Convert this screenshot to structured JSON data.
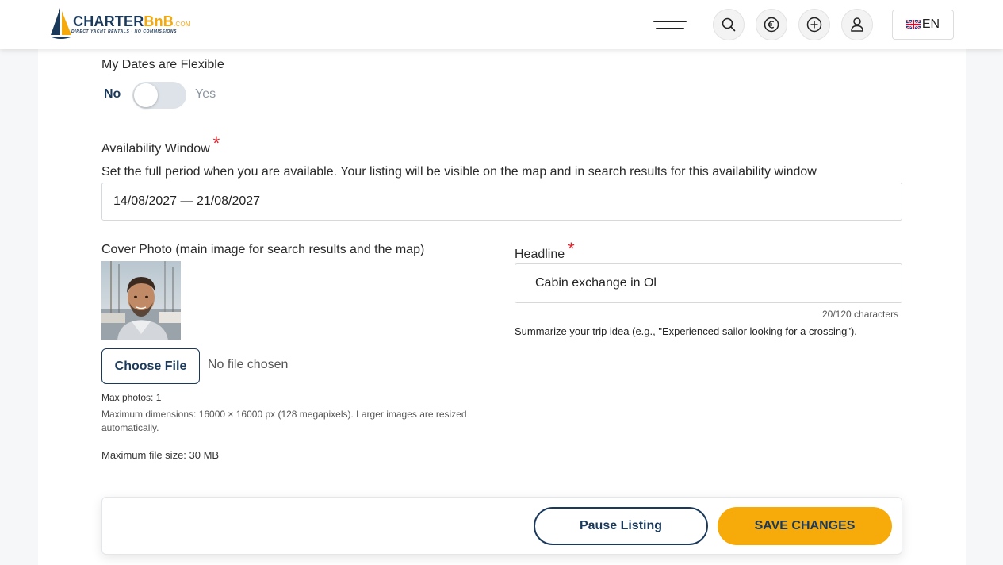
{
  "header": {
    "logo_name": "CHARTER",
    "logo_accent": "BnB",
    "logo_domain": ".COM",
    "logo_tagline": "DIRECT YACHT RENTALS · NO COMMISSIONS",
    "language": "EN",
    "icons": [
      "menu-icon",
      "search-icon",
      "euro-icon",
      "plus-circle-icon",
      "user-icon",
      "uk-flag-icon"
    ]
  },
  "flexible": {
    "label": "My Dates are Flexible",
    "no_label": "No",
    "yes_label": "Yes",
    "state": "No"
  },
  "availability": {
    "label": "Availability Window",
    "required_mark": "*",
    "help": "Set the full period when you are available. Your listing will be visible on the map and in search results for this availability window",
    "value": "14/08/2027 — 21/08/2027"
  },
  "cover_photo": {
    "label": "Cover Photo (main image for search results and the map)",
    "choose_label": "Choose File",
    "no_file": "No file chosen",
    "max_photos": "Max photos: 1",
    "max_dimensions": "Maximum dimensions: 16000 × 16000 px (128 megapixels). Larger images are resized automatically.",
    "max_size": "Maximum file size: 30 MB"
  },
  "headline": {
    "label": "Headline",
    "required_mark": "*",
    "value": "Cabin exchange in Ol",
    "counter": "20/120 characters",
    "help": "Summarize your trip idea (e.g., \"Experienced sailor looking for a crossing\")."
  },
  "actions": {
    "pause_label": "Pause Listing",
    "save_label": "SAVE CHANGES"
  },
  "colors": {
    "brand_navy": "#1b3a5b",
    "accent_orange": "#f7ab0a",
    "required_red": "#e0242c"
  }
}
